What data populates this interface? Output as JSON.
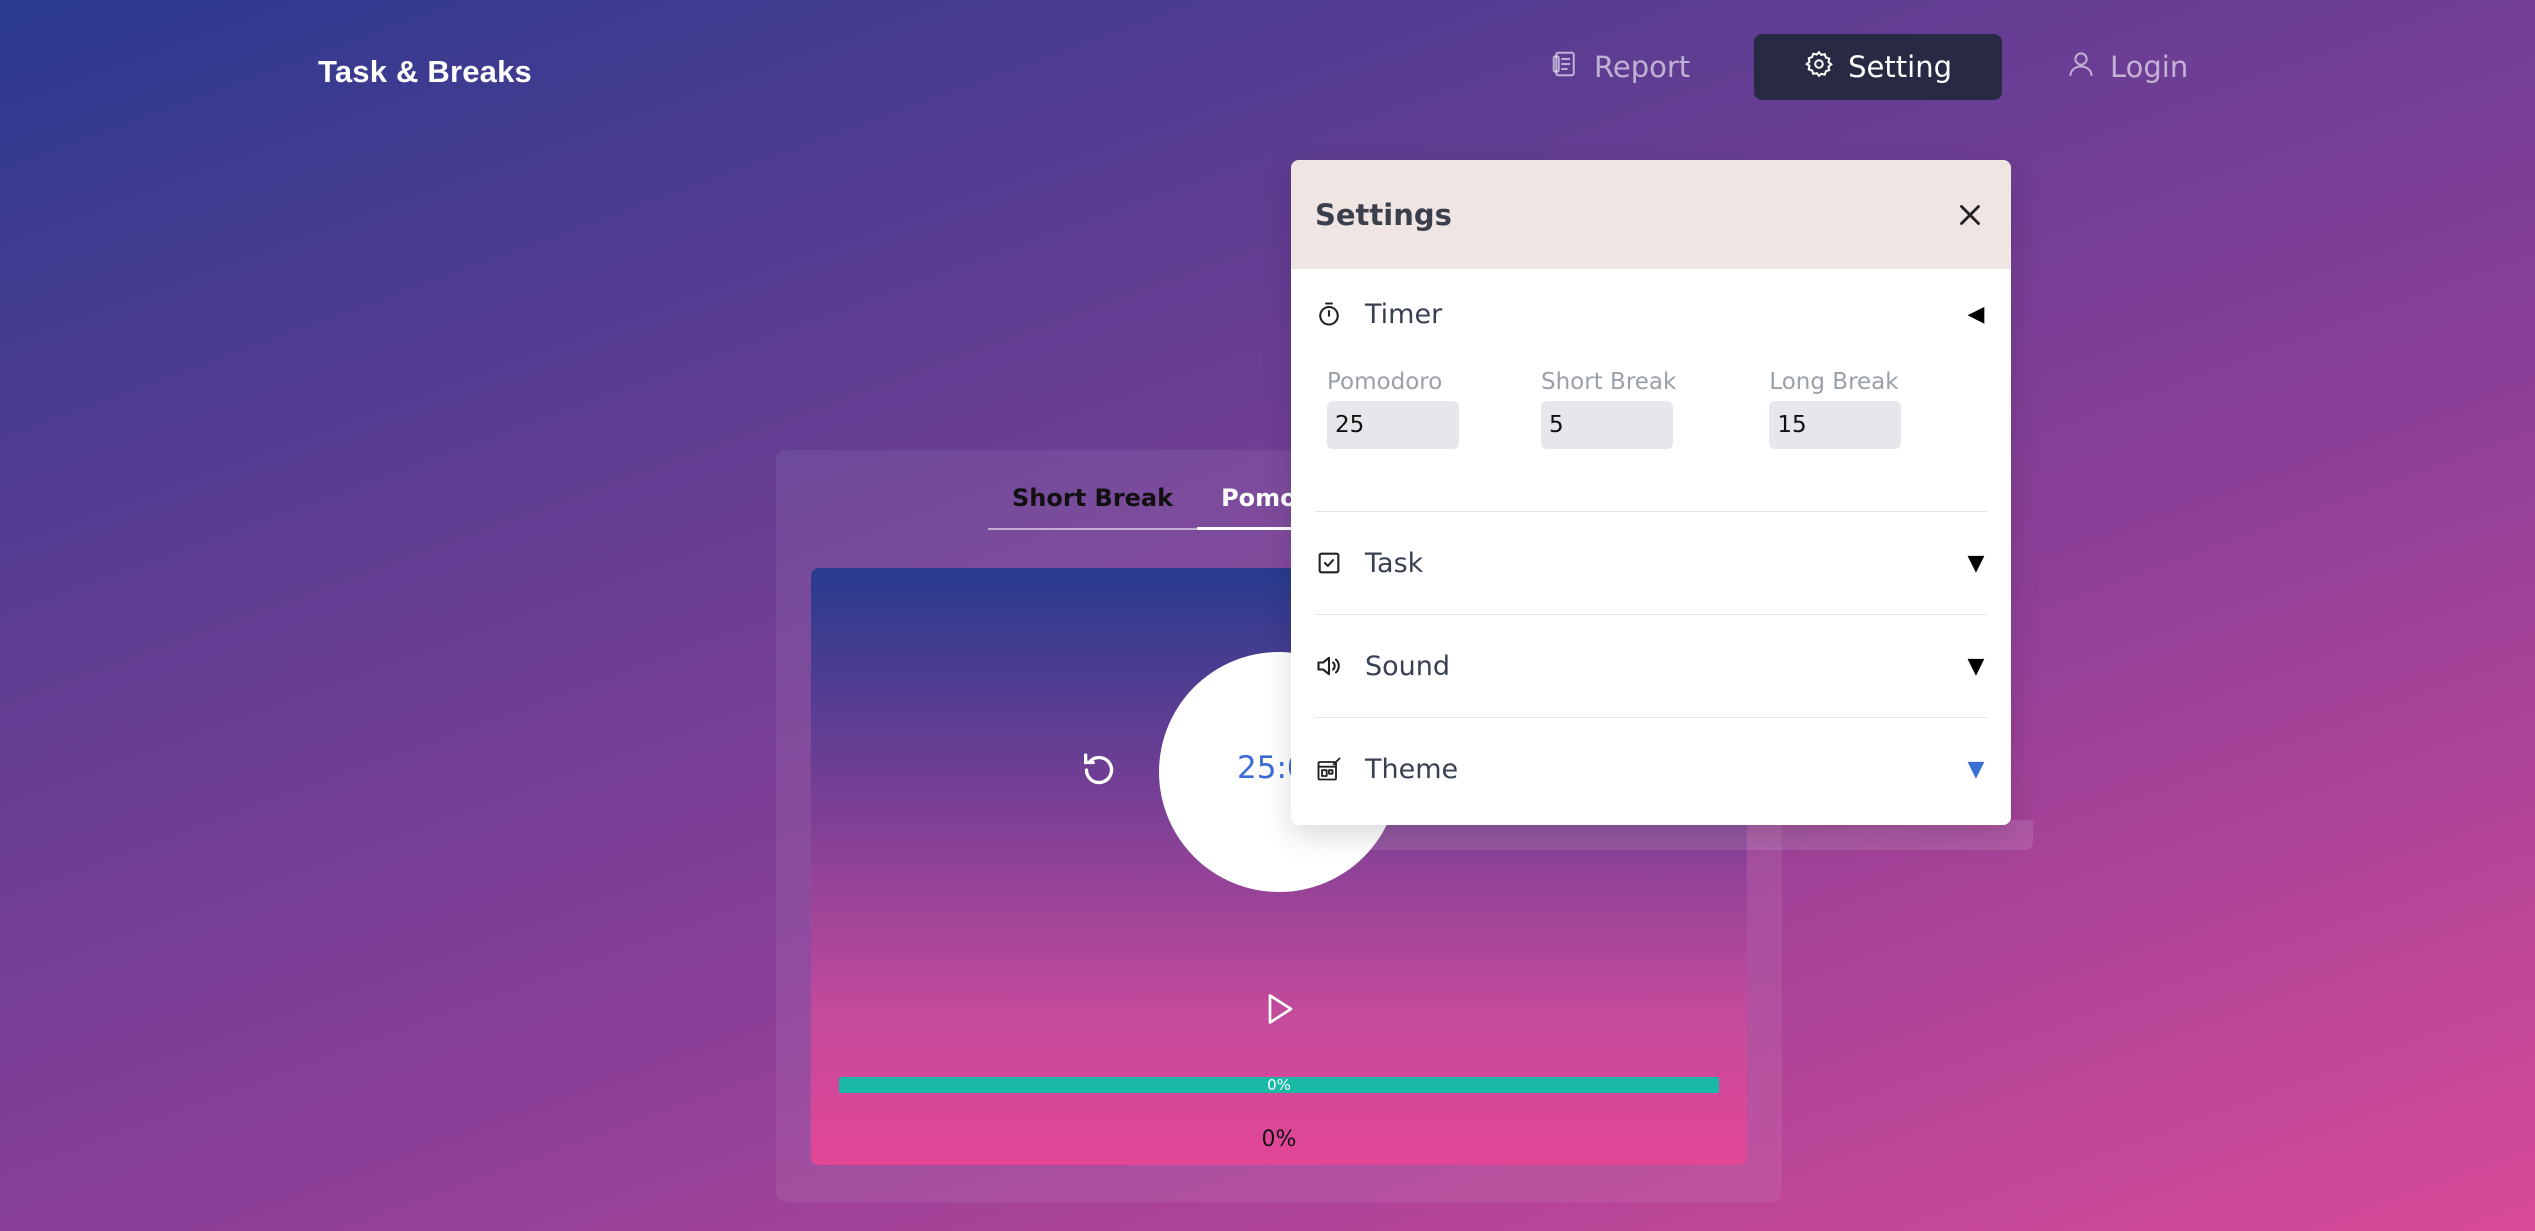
{
  "brand": "Task & Breaks",
  "nav": {
    "report_label": "Report",
    "setting_label": "Setting",
    "login_label": "Login"
  },
  "mode_tabs": [
    {
      "label": "Short Break",
      "active": false
    },
    {
      "label": "Pomodoro",
      "active": true
    }
  ],
  "timer": {
    "time": "25:00",
    "progress_percent": 0,
    "progress_label": "0%",
    "progress_text": "0%"
  },
  "settings_modal": {
    "title": "Settings",
    "sections": {
      "timer": {
        "title": "Timer",
        "caret": "◀",
        "fields": {
          "pomodoro": {
            "label": "Pomodoro",
            "value": "25"
          },
          "short_break": {
            "label": "Short Break",
            "value": "5"
          },
          "long_break": {
            "label": "Long Break",
            "value": "15"
          }
        }
      },
      "task": {
        "title": "Task",
        "caret": "▼"
      },
      "sound": {
        "title": "Sound",
        "caret": "▼"
      },
      "theme": {
        "title": "Theme",
        "caret": "▼"
      }
    }
  },
  "colors": {
    "accent_blue": "#3b6fd6",
    "progress_teal": "#19b9a6",
    "nav_active_bg": "#272a42",
    "modal_header_bg": "#efe6e4"
  }
}
